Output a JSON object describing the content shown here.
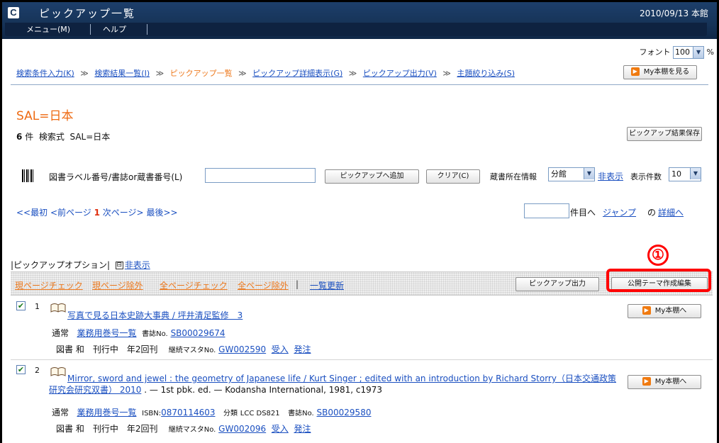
{
  "window": {
    "title": "ピックアップ一覧",
    "date_branch": "2010/09/13 本館",
    "logo_letter": "C"
  },
  "menu": [
    {
      "label": "メニュー(M)"
    },
    {
      "label": "ヘルプ"
    }
  ],
  "font": {
    "label": "フォント",
    "value": "100",
    "unit": "%"
  },
  "breadcrumb": {
    "items": [
      {
        "label": "検索条件入力(K)"
      },
      {
        "label": "検索結果一覧(I)"
      },
      {
        "label": "ピックアップ一覧"
      },
      {
        "label": "ピックアップ詳細表示(G)"
      },
      {
        "label": "ピックアップ出力(V)"
      },
      {
        "label": "主題絞り込み(S)"
      }
    ],
    "separator": "≫"
  },
  "my_shelf_button": "My本棚を見る",
  "query": {
    "title": "SAL=日本",
    "count": "6",
    "count_unit": "件",
    "expr_label": "検索式",
    "expr": "SAL=日本"
  },
  "save_pickup_button": "ピックアップ結果保存",
  "label_input": {
    "label": "図書ラベル番号/書誌or蔵書番号(L)",
    "value": "",
    "add_button": "ピックアップへ追加",
    "clear_button": "クリア(C)"
  },
  "holdings": {
    "label": "蔵書所在情報",
    "value": "分館",
    "hide_link": "非表示",
    "per_page_label": "表示件数",
    "per_page": "10"
  },
  "pager": {
    "first": "<<最初",
    "prev": "<前ページ",
    "current": "1",
    "next": "次ページ>",
    "last": "最後>>"
  },
  "jump": {
    "value": "",
    "suffix": "件目へ",
    "jump_link": "ジャンプ",
    "detail_prefix": "の",
    "detail_link": "詳細へ"
  },
  "options": {
    "label": "|ピックアップオプション|",
    "toggle_icon": "⊟",
    "hide_link": "非表示"
  },
  "actions": {
    "check_page": {
      "first": "現",
      "rest": "ページチェック"
    },
    "exclude_page": {
      "first": "現",
      "rest": "ページ除外"
    },
    "check_all": {
      "first": "全",
      "rest": "ページチェック"
    },
    "exclude_all": {
      "first": "全",
      "rest": "ページ除外"
    },
    "separator": "|",
    "refresh": "一覧更新",
    "output_button": "ピックアップ出力",
    "theme_button": "公開テーマ作成編集"
  },
  "callout": "①",
  "items": [
    {
      "no": "1",
      "checked": true,
      "title": "写真で見る日本史跡大事典 / 坪井清足監修　3",
      "extra": "",
      "type": "通常",
      "series_link": "業務用巻号一覧",
      "id1_label": "",
      "id1": "",
      "biblio_label": "書誌No.",
      "biblio": "SB00029674",
      "class_label": "",
      "class_value": "",
      "status": "図書 和　刊行中　年2回刊",
      "master_label": "継続マスタNo.",
      "master": "GW002590",
      "receive": "受入",
      "order": "発注",
      "my_button": "My本棚へ"
    },
    {
      "no": "2",
      "checked": true,
      "title": "Mirror, sword and jewel : the geometry of Japanese life / Kurt Singer ; edited with an introduction by Richard Storry（日本交通政策研究会研究双書） 2010",
      "extra": ". — 1st pbk. ed. — Kodansha International, 1981, c1973",
      "type": "通常",
      "series_link": "業務用巻号一覧",
      "id1_label": "ISBN:",
      "id1": "0870114603",
      "biblio_label": "書誌No.",
      "biblio": "SB00029580",
      "class_label": "分類",
      "class_value": "LCC DS821",
      "status": "図書 和　刊行中　年2回刊",
      "master_label": "継続マスタNo.",
      "master": "GW002096",
      "receive": "受入",
      "order": "発注",
      "my_button": "My本棚へ"
    }
  ],
  "colors": {
    "accent_orange": "#ee7a1f",
    "link_blue": "#1a4fc0",
    "title_bar": "#163357",
    "highlight_red": "#ff0000"
  }
}
